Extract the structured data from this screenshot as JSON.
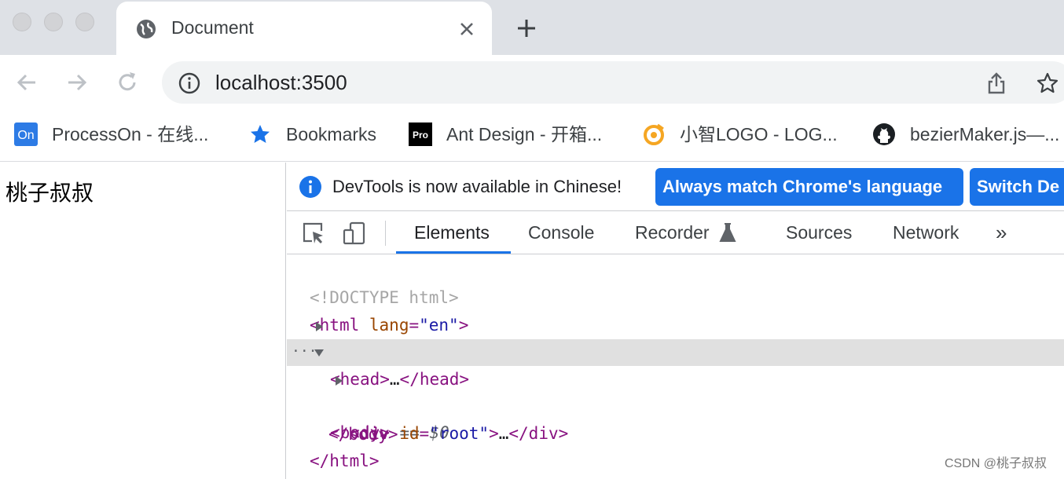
{
  "window": {
    "tab": {
      "title": "Document",
      "favicon": "globe-icon"
    },
    "new_tab_icon": "plus-icon",
    "controls": [
      "close",
      "minimize",
      "zoom"
    ]
  },
  "toolbar": {
    "back_icon": "arrow-left-icon",
    "forward_icon": "arrow-right-icon",
    "reload_icon": "reload-icon",
    "url": "localhost:3500",
    "info_icon": "info-icon",
    "share_icon": "share-icon",
    "bookmark_star_icon": "star-icon"
  },
  "bookmarks": [
    {
      "label": "ProcessOn - 在线...",
      "icon": "processon-icon",
      "icon_text": "On"
    },
    {
      "label": "Bookmarks",
      "icon": "star-icon"
    },
    {
      "label": "Ant Design - 开箱...",
      "icon": "pro-icon",
      "icon_text": "Pro"
    },
    {
      "label": "小智LOGO - LOG...",
      "icon": "logo-icon"
    },
    {
      "label": "bezierMaker.js—...",
      "icon": "github-icon"
    }
  ],
  "page": {
    "text": "桃子叔叔"
  },
  "devtools": {
    "infobar": {
      "message": "DevTools is now available in Chinese!",
      "buttons": [
        "Always match Chrome's language",
        "Switch De"
      ]
    },
    "tabs": [
      {
        "label": "Elements",
        "active": true
      },
      {
        "label": "Console",
        "active": false
      },
      {
        "label": "Recorder",
        "active": false,
        "icon": "flask-icon"
      },
      {
        "label": "Sources",
        "active": false
      },
      {
        "label": "Network",
        "active": false
      }
    ],
    "more_tabs": "»",
    "dom": {
      "doctype": "<!DOCTYPE html>",
      "html_tag": "html",
      "lang_attr": "lang",
      "lang_value": "\"en\"",
      "head_tag": "head",
      "body_tag": "body",
      "selected_eq": "==",
      "selected_ref": "$0",
      "div_tag": "div",
      "id_attr": "id",
      "id_value": "\"root\"",
      "ellipsis": "…",
      "dots": "···"
    }
  },
  "watermark": "CSDN @桃子叔叔",
  "colors": {
    "accent": "#1a73e8",
    "tag": "#881280",
    "attr": "#994500",
    "value": "#1a1aa6",
    "tabstrip": "#dee1e6"
  }
}
